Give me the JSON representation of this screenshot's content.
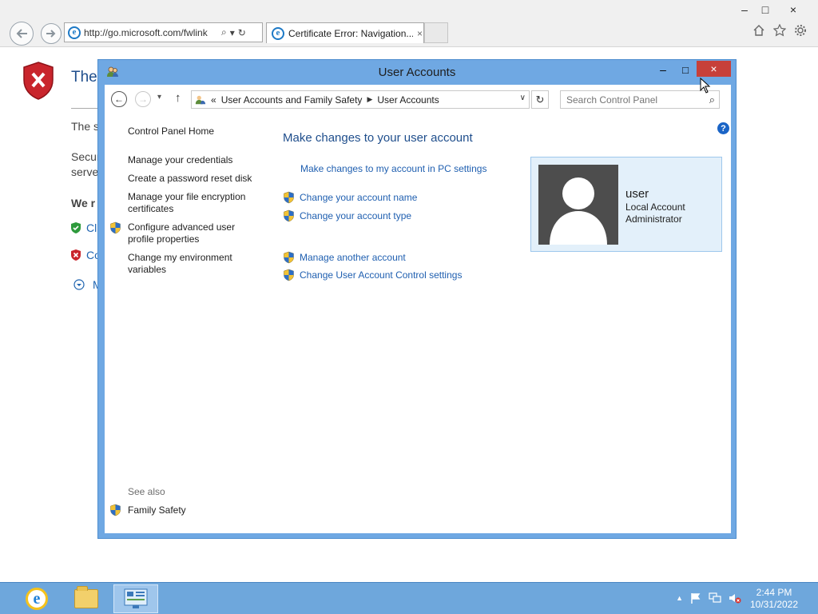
{
  "browser": {
    "address": "http://go.microsoft.com/fwlink",
    "tab_title": "Certificate Error: Navigation...",
    "tab_close": "×",
    "back_icon": "back-arrow",
    "forward_icon": "forward-arrow",
    "search_icon": "⌕",
    "dropdown_icon": "▾",
    "refresh_icon": "↻",
    "minimize": "–",
    "maximize": "□",
    "close": "×"
  },
  "error_page": {
    "title_partial": "Ther",
    "line1_partial": "The s",
    "line2a_partial": "Secur",
    "line2b_partial": "serve",
    "bold_partial": "We r",
    "option1_partial": "Cl",
    "option2_partial": "Co",
    "more_partial": "M"
  },
  "window": {
    "title": "User Accounts",
    "minimize": "–",
    "maximize": "□",
    "close": "×"
  },
  "navbar": {
    "back": "←",
    "forward": "→",
    "recent": "▾",
    "up": "↑",
    "breadcrumb_prefix": "«",
    "breadcrumb": [
      "User Accounts and Family Safety",
      "User Accounts"
    ],
    "separator": "▶",
    "dropdown": "∨",
    "refresh": "↻",
    "search_placeholder": "Search Control Panel",
    "search_icon": "⌕",
    "help": "?"
  },
  "left_pane": {
    "home": "Control Panel Home",
    "links": [
      "Manage your credentials",
      "Create a password reset disk",
      "Manage your file encryption certificates",
      "Configure advanced user profile properties",
      "Change my environment variables"
    ],
    "see_also_label": "See also",
    "see_also": [
      "Family Safety"
    ]
  },
  "main": {
    "heading": "Make changes to your user account",
    "pc_settings_link": "Make changes to my account in PC settings",
    "tasks": [
      "Change your account name",
      "Change your account type",
      "Manage another account",
      "Change User Account Control settings"
    ]
  },
  "account": {
    "name": "user",
    "type": "Local Account",
    "role": "Administrator"
  },
  "taskbar": {
    "time": "2:44 PM",
    "date": "10/31/2022",
    "tray_up": "▲"
  },
  "colors": {
    "window_frame": "#6fa8e3",
    "close_button": "#c7403a",
    "link": "#1f5fb0",
    "heading": "#1f4e8c",
    "taskbar": "#6ea7dc"
  }
}
